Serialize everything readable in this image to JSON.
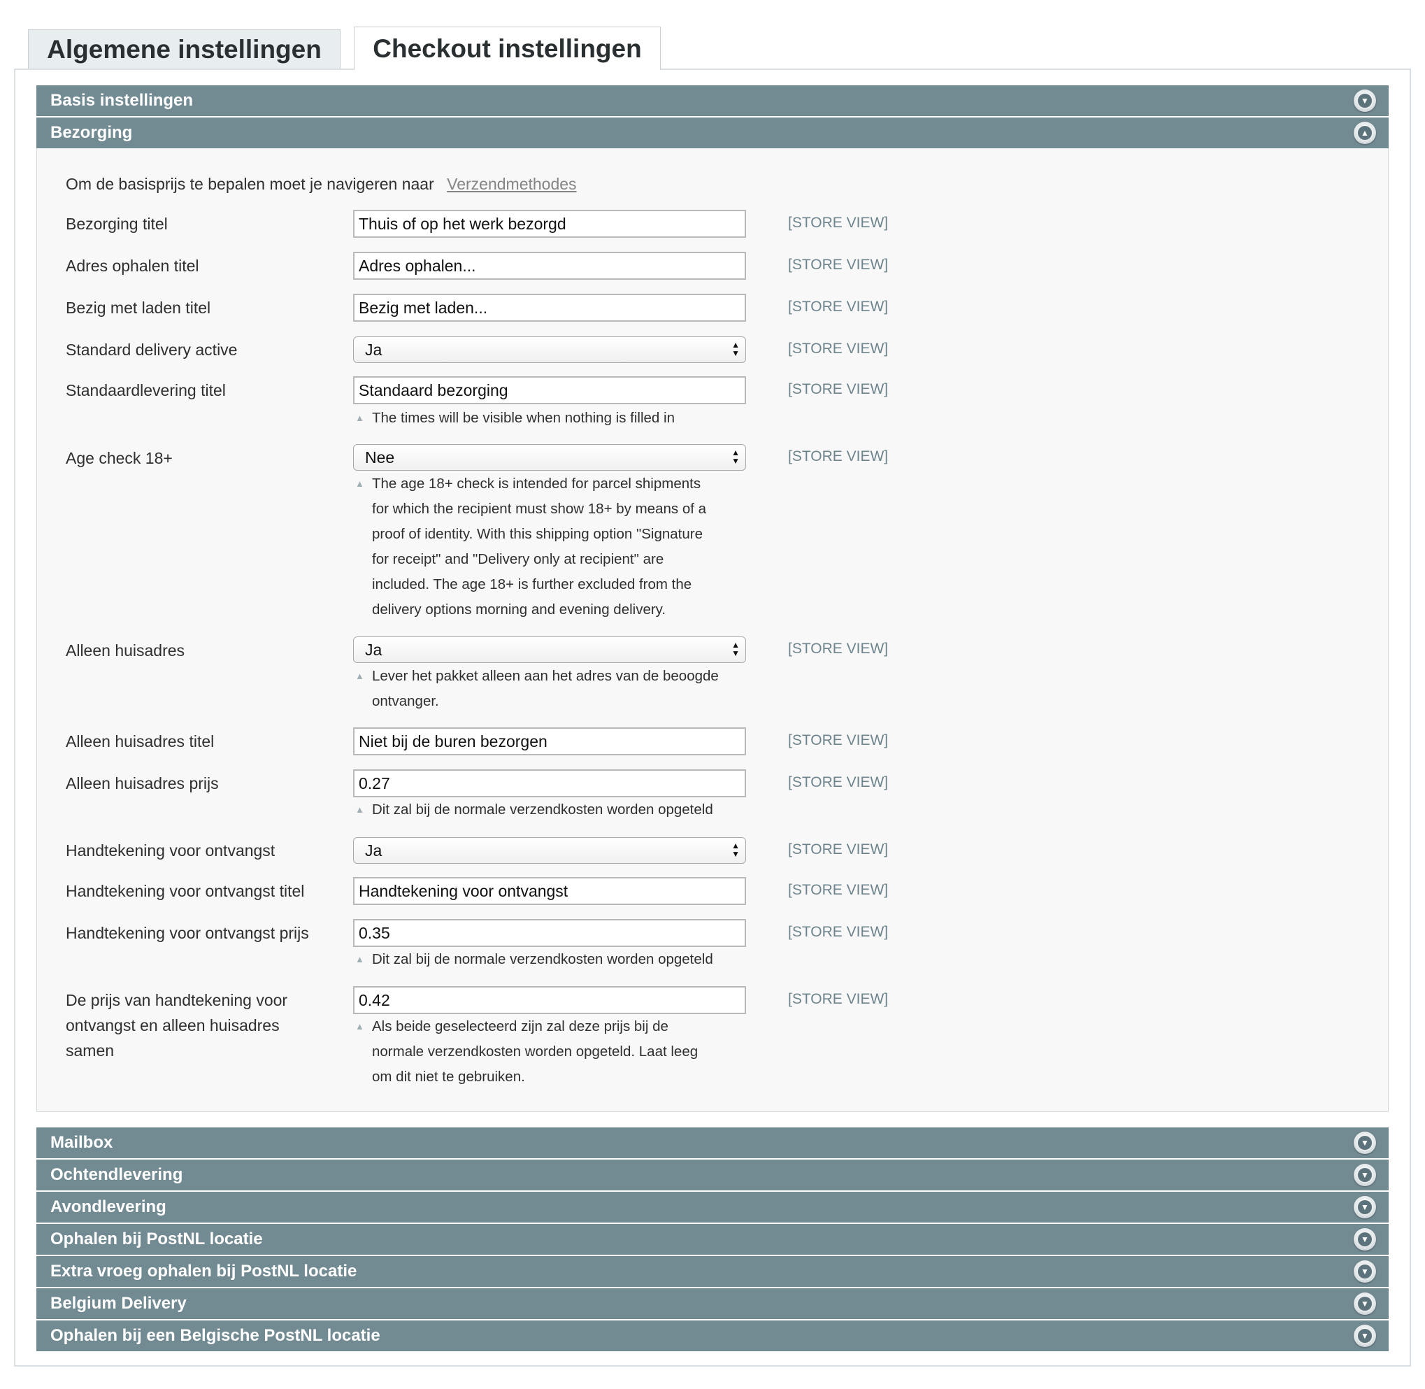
{
  "tabs": [
    {
      "label": "Algemene instellingen",
      "active": false
    },
    {
      "label": "Checkout instellingen",
      "active": true
    }
  ],
  "sections_top": [
    {
      "title": "Basis instellingen",
      "state": "collapsed"
    },
    {
      "title": "Bezorging",
      "state": "expanded"
    }
  ],
  "bezorging": {
    "intro_text": "Om de basisprijs te bepalen moet je navigeren naar",
    "intro_link": "Verzendmethodes",
    "scope_label": "[STORE VIEW]",
    "fields": [
      {
        "label": "Bezorging titel",
        "type": "text",
        "value": "Thuis of op het werk bezorgd"
      },
      {
        "label": "Adres ophalen titel",
        "type": "text",
        "value": "Adres ophalen..."
      },
      {
        "label": "Bezig met laden titel",
        "type": "text",
        "value": "Bezig met laden..."
      },
      {
        "label": "Standard delivery active",
        "type": "select",
        "value": "Ja"
      },
      {
        "label": "Standaardlevering titel",
        "type": "text",
        "value": "Standaard bezorging",
        "note": "The times will be visible when nothing is filled in"
      },
      {
        "label": "Age check 18+",
        "type": "select",
        "value": "Nee",
        "note_lines": [
          "The age 18+ check is intended for parcel shipments",
          "for which the recipient must show 18+ by means of a",
          "proof of identity. With this shipping option \"Signature",
          "for receipt\" and \"Delivery only at recipient\" are",
          "included. The age 18+ is further excluded from the",
          "delivery options morning and evening delivery."
        ]
      },
      {
        "label": "Alleen huisadres",
        "type": "select",
        "value": "Ja",
        "note_lines": [
          "Lever het pakket alleen aan het adres van de beoogde",
          "ontvanger."
        ]
      },
      {
        "label": "Alleen huisadres titel",
        "type": "text",
        "value": "Niet bij de buren bezorgen"
      },
      {
        "label": "Alleen huisadres prijs",
        "type": "text",
        "value": "0.27",
        "note": "Dit zal bij de normale verzendkosten worden opgeteld"
      },
      {
        "label": "Handtekening voor ontvangst",
        "type": "select",
        "value": "Ja"
      },
      {
        "label": "Handtekening voor ontvangst titel",
        "type": "text",
        "value": "Handtekening voor ontvangst"
      },
      {
        "label": "Handtekening voor ontvangst prijs",
        "type": "text",
        "value": "0.35",
        "note": "Dit zal bij de normale verzendkosten worden opgeteld"
      },
      {
        "label_lines": [
          "De prijs van handtekening voor",
          "ontvangst en alleen huisadres",
          "samen"
        ],
        "type": "text",
        "value": "0.42",
        "note_lines": [
          "Als beide geselecteerd zijn zal deze prijs bij de",
          "normale verzendkosten worden opgeteld. Laat leeg",
          "om dit niet te gebruiken."
        ]
      }
    ]
  },
  "sections_bottom": [
    {
      "title": "Mailbox"
    },
    {
      "title": "Ochtendlevering"
    },
    {
      "title": "Avondlevering"
    },
    {
      "title": "Ophalen bij PostNL locatie"
    },
    {
      "title": "Extra vroeg ophalen bij PostNL locatie"
    },
    {
      "title": "Belgium Delivery"
    },
    {
      "title": "Ophalen bij een Belgische PostNL locatie"
    }
  ],
  "icons": {
    "collapsed": "chevron-down-icon",
    "expanded": "chevron-up-icon"
  },
  "colors": {
    "section_header": "#728a92",
    "scope_text": "#6e848c",
    "tab_inactive_bg": "#e8eeef"
  }
}
